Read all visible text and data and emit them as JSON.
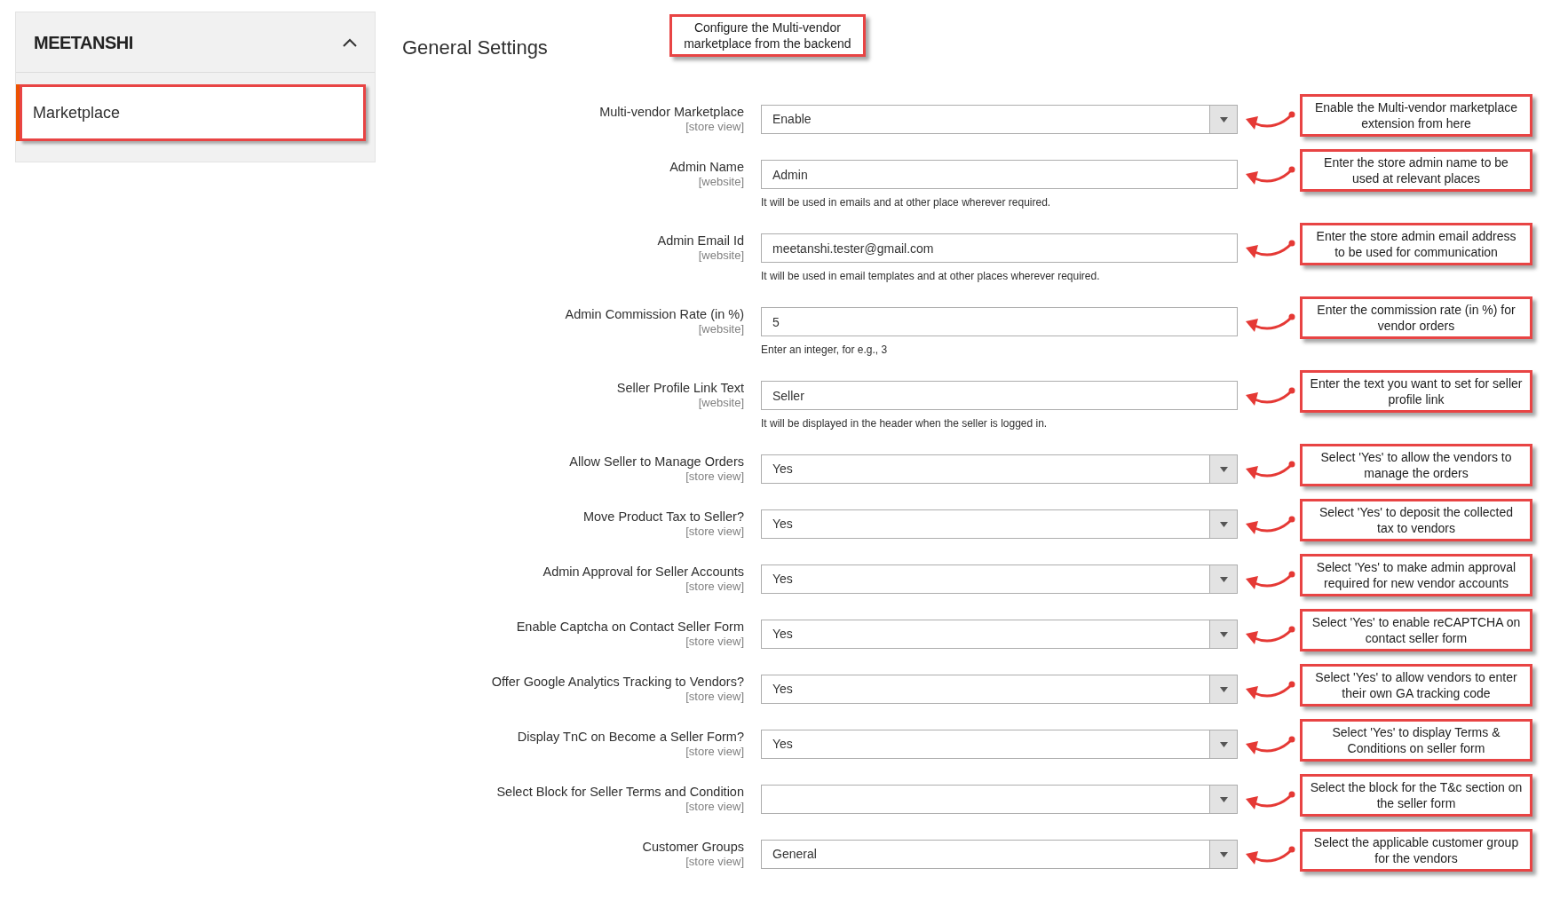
{
  "sidebar": {
    "logo": "MEETANSHI",
    "expanded": true,
    "items": [
      {
        "label": "Marketplace",
        "selected": true
      }
    ]
  },
  "page_title": "General Settings",
  "top_note": "Configure the Multi-vendor marketplace from the backend",
  "fields": [
    {
      "kind": "select",
      "label": "Multi-vendor Marketplace",
      "scope": "[store view]",
      "value": "Enable",
      "note": "Enable the Multi-vendor marketplace extension from here"
    },
    {
      "kind": "text",
      "label": "Admin Name",
      "scope": "[website]",
      "value": "Admin",
      "hint": "It will be used in emails and at other place wherever required.",
      "note": "Enter the store admin name to be used at relevant places"
    },
    {
      "kind": "text",
      "label": "Admin Email Id",
      "scope": "[website]",
      "value": "meetanshi.tester@gmail.com",
      "hint": "It will be used in email templates and at other places wherever required.",
      "note": "Enter the store admin email address to be used for communication"
    },
    {
      "kind": "text",
      "label": "Admin Commission Rate (in %)",
      "scope": "[website]",
      "value": "5",
      "hint": "Enter an integer, for e.g., 3",
      "note": "Enter the commission rate (in %) for vendor orders"
    },
    {
      "kind": "text",
      "label": "Seller Profile Link Text",
      "scope": "[website]",
      "value": "Seller",
      "hint": "It will be displayed in the header when the seller is logged in.",
      "note": "Enter the text you want to set for seller profile link"
    },
    {
      "kind": "select",
      "label": "Allow Seller to Manage Orders",
      "scope": "[store view]",
      "value": "Yes",
      "note": "Select 'Yes' to allow the vendors to manage the orders"
    },
    {
      "kind": "select",
      "label": "Move Product Tax to Seller?",
      "scope": "[store view]",
      "value": "Yes",
      "note": "Select 'Yes' to deposit the collected tax to vendors"
    },
    {
      "kind": "select",
      "label": "Admin Approval for Seller Accounts",
      "scope": "[store view]",
      "value": "Yes",
      "note": "Select 'Yes' to make admin approval required for new vendor accounts"
    },
    {
      "kind": "select",
      "label": "Enable Captcha on Contact Seller Form",
      "scope": "[store view]",
      "value": "Yes",
      "note": "Select 'Yes' to enable reCAPTCHA on contact seller form"
    },
    {
      "kind": "select",
      "label": "Offer Google Analytics Tracking to Vendors?",
      "scope": "[store view]",
      "value": "Yes",
      "note": "Select 'Yes' to allow vendors to enter their own GA tracking code"
    },
    {
      "kind": "select",
      "label": "Display TnC on Become a Seller Form?",
      "scope": "[store view]",
      "value": "Yes",
      "note": "Select 'Yes' to display Terms & Conditions on seller form"
    },
    {
      "kind": "select",
      "label": "Select Block for Seller Terms and Condition",
      "scope": "[store view]",
      "note": "Select the block for the T&c section on the seller form"
    },
    {
      "kind": "select",
      "label": "Customer Groups",
      "scope": "[store view]",
      "value": "General",
      "note": "Select the applicable customer group for the vendors"
    }
  ]
}
